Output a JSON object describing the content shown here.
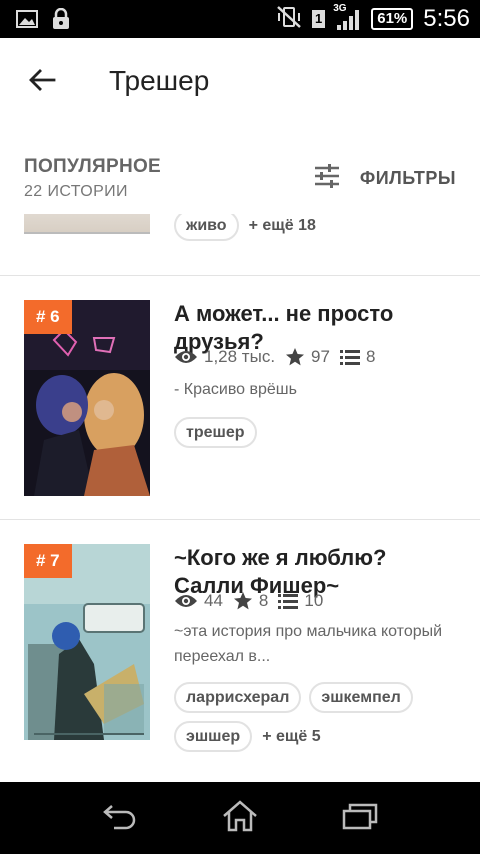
{
  "status_bar": {
    "time": "5:56",
    "battery": "61%",
    "network": "3G",
    "sim": "1",
    "icons": [
      "image-icon",
      "lock-icon",
      "no-vibrate-icon",
      "sim-icon",
      "signal-icon",
      "battery-icon"
    ]
  },
  "app_bar": {
    "title": "Трешер",
    "back_icon": "arrow-back-icon"
  },
  "list_header": {
    "sort_label": "ПОПУЛЯРНОЕ",
    "count_label": "22 ИСТОРИИ",
    "filter_label": "ФИЛЬТРЫ",
    "filter_icon": "sliders-icon"
  },
  "partial_item": {
    "tags": [
      "живо"
    ],
    "more": "+ ещё 18"
  },
  "stories": [
    {
      "rank": "# 6",
      "title": "А может... не просто друзья?",
      "views": "1,28 тыс.",
      "votes": "97",
      "parts": "8",
      "description": "- Красиво врёшь",
      "tags": [
        "трешер"
      ],
      "more": ""
    },
    {
      "rank": "# 7",
      "title": "~Кого же я люблю? Салли Фишер~",
      "views": "44",
      "votes": "8",
      "parts": "10",
      "description": "~эта история про мальчика который переехал в...",
      "tags": [
        "ларрисхерал",
        "эшкемпел",
        "эшшер"
      ],
      "more": "+ ещё 5"
    }
  ],
  "nav_bar": {
    "icons": [
      "back-nav-icon",
      "home-nav-icon",
      "recents-nav-icon"
    ]
  },
  "colors": {
    "accent": "#f36b2b",
    "status_bar_bg": "#000000",
    "nav_bar_bg": "#000000",
    "text_primary": "#222222",
    "text_secondary": "#666666"
  }
}
